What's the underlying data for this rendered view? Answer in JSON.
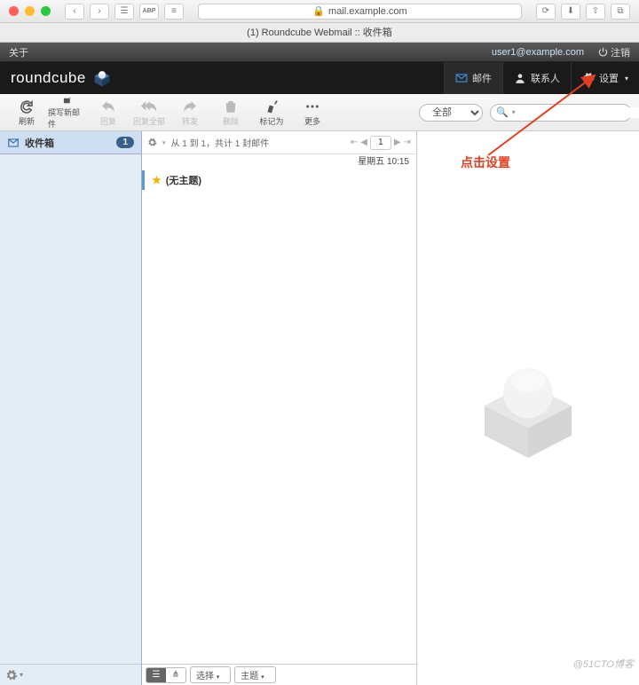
{
  "browser": {
    "url_host": "mail.example.com",
    "tab_title": "(1) Roundcube Webmail :: 收件箱"
  },
  "about_bar": {
    "label": "关于",
    "user_email": "user1@example.com",
    "logout": "注销"
  },
  "brand": {
    "name": "roundcube"
  },
  "nav": {
    "mail": "邮件",
    "contacts": "联系人",
    "settings": "设置"
  },
  "toolbar": {
    "refresh": "刷新",
    "compose": "撰写新邮件",
    "reply": "回复",
    "reply_all": "回复全部",
    "forward": "转发",
    "delete": "删除",
    "mark": "标记为",
    "more": "更多",
    "scope": "全部",
    "search_placeholder": ""
  },
  "sidebar": {
    "inbox": "收件箱",
    "inbox_count": "1"
  },
  "msglist": {
    "summary": "从 1 到 1，共计 1 封邮件",
    "page": "1",
    "date": "星期五 10:15",
    "subject": "(无主题)",
    "footer_select": "选择",
    "footer_topic": "主题"
  },
  "annotation": {
    "text": "点击设置"
  },
  "watermark": "@51CTO博客"
}
